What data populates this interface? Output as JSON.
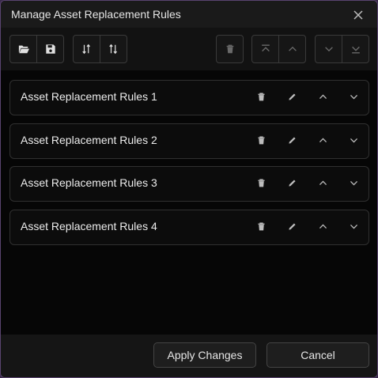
{
  "dialog": {
    "title": "Manage Asset Replacement Rules"
  },
  "toolbar": {
    "open_icon": "folder-open-icon",
    "save_icon": "save-icon",
    "sort_asc_icon": "sort-ascending-icon",
    "sort_desc_icon": "sort-descending-icon",
    "delete_icon": "trash-icon",
    "move_top_icon": "move-to-top-icon",
    "move_up_icon": "chevron-up-icon",
    "move_down_icon": "chevron-down-icon",
    "move_bottom_icon": "move-to-bottom-icon"
  },
  "rules": [
    {
      "label": "Asset Replacement Rules 1"
    },
    {
      "label": "Asset Replacement Rules 2"
    },
    {
      "label": "Asset Replacement Rules 3"
    },
    {
      "label": "Asset Replacement Rules 4"
    }
  ],
  "footer": {
    "apply_label": "Apply Changes",
    "cancel_label": "Cancel"
  },
  "colors": {
    "background": "#0b0b0b",
    "border": "#303030",
    "text": "#ececec",
    "icon_active": "#e0e0e0",
    "icon_disabled": "#6a6a6a"
  }
}
